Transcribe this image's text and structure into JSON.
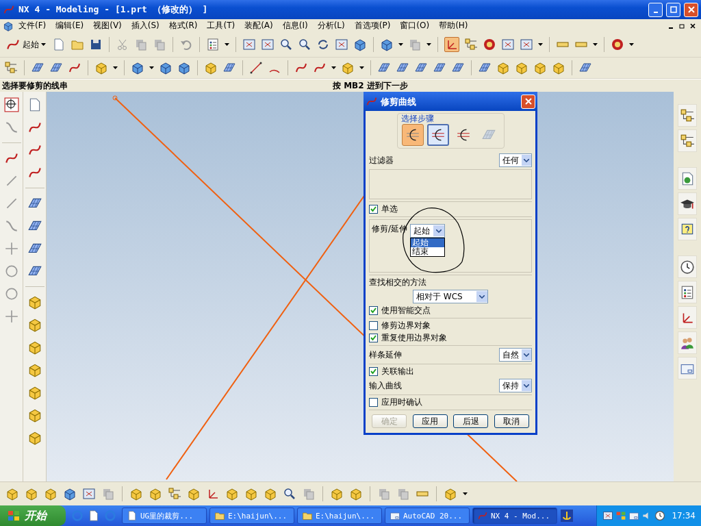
{
  "window": {
    "title": "NX 4 - Modeling - [1.prt （修改的） ]"
  },
  "menu": [
    {
      "label": "文件(F)"
    },
    {
      "label": "编辑(E)"
    },
    {
      "label": "视图(V)"
    },
    {
      "label": "插入(S)"
    },
    {
      "label": "格式(R)"
    },
    {
      "label": "工具(T)"
    },
    {
      "label": "装配(A)"
    },
    {
      "label": "信息(I)"
    },
    {
      "label": "分析(L)"
    },
    {
      "label": "首选项(P)"
    },
    {
      "label": "窗口(O)"
    },
    {
      "label": "帮助(H)"
    }
  ],
  "toolbar": {
    "start_button": "起始"
  },
  "status": {
    "prompt": "选择要修剪的线串",
    "hint": "按 MB2 进到下一步"
  },
  "dialog": {
    "title": "修剪曲线",
    "steps_label": "选择步骤",
    "steps": [
      {
        "active": true,
        "selected": false,
        "disabled": false
      },
      {
        "active": false,
        "selected": true,
        "disabled": false
      },
      {
        "active": false,
        "selected": false,
        "disabled": false
      },
      {
        "active": false,
        "selected": false,
        "disabled": true
      }
    ],
    "sections": [
      [
        {
          "kind": "select",
          "label": "过滤器",
          "value": "任何"
        },
        {
          "kind": "listbox"
        }
      ],
      [
        {
          "kind": "checkbox",
          "label": "单选",
          "checked": true
        }
      ],
      [
        {
          "kind": "open_select",
          "label": "修剪/延伸",
          "value": "起始",
          "options": [
            {
              "label": "起始",
              "selected": true
            },
            {
              "label": "结束",
              "selected": false
            }
          ]
        }
      ],
      [
        {
          "kind": "heading",
          "label": "查找相交的方法"
        },
        {
          "kind": "center_select",
          "value": "相对于 WCS"
        },
        {
          "kind": "checkbox",
          "label": "使用智能交点",
          "checked": true
        }
      ],
      [
        {
          "kind": "checkbox",
          "label": "修剪边界对象",
          "checked": false
        },
        {
          "kind": "checkbox",
          "label": "重复使用边界对象",
          "checked": true
        }
      ],
      [
        {
          "kind": "select",
          "label": "样条延伸",
          "value": "自然"
        }
      ],
      [
        {
          "kind": "checkbox",
          "label": "关联输出",
          "checked": true
        },
        {
          "kind": "select",
          "label": "输入曲线",
          "value": "保持"
        }
      ],
      [
        {
          "kind": "checkbox",
          "label": "应用时确认",
          "checked": false
        }
      ]
    ],
    "buttons": [
      {
        "label": "确定",
        "disabled": true
      },
      {
        "label": "应用",
        "disabled": false
      },
      {
        "label": "后退",
        "disabled": false
      },
      {
        "label": "取消",
        "disabled": false
      }
    ]
  },
  "taskbar": {
    "start": "开始",
    "tasks": [
      {
        "label": "UG里的裁剪...",
        "selected": false
      },
      {
        "label": "E:\\haijun\\...",
        "selected": false
      },
      {
        "label": "E:\\haijun\\...",
        "selected": false
      },
      {
        "label": "AutoCAD 20...",
        "selected": false
      },
      {
        "label": "NX 4 - Mod...",
        "selected": true
      }
    ],
    "clock": "17:34"
  }
}
